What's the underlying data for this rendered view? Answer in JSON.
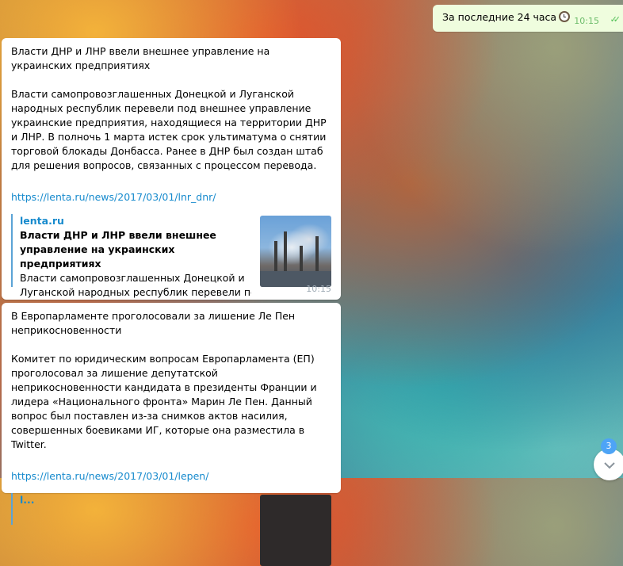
{
  "outgoing": {
    "text": "За последние 24 часа",
    "time": "10:15",
    "status_icon": "double-check-icon",
    "emoji_icon": "clock-icon"
  },
  "messages": [
    {
      "headline": "Власти ДНР и ЛНР ввели внешнее управление на украинских предприятиях",
      "body": "Власти самопровозглашенных Донецкой и Луганской народных республик перевели под внешнее управление украинские предприятия, находящиеся на территории ДНР и ЛНР. В полночь 1 марта истек срок ультиматума о снятии торговой блокады Донбасса. Ранее в ДНР был создан штаб для решения вопросов, связанных с процессом перевода.",
      "link": "https://lenta.ru/news/2017/03/01/lnr_dnr/",
      "preview": {
        "site": "lenta.ru",
        "title": "Власти ДНР и ЛНР ввели внешнее управление на украинских предприятиях",
        "text_line1": "Власти самопровозглашенных Донецкой и",
        "text_line2": "Луганской народных республик перевели по…"
      },
      "time": "10:15"
    },
    {
      "headline": "В Европарламенте проголосовали за лишение Ле Пен неприкосновенности",
      "body": "Комитет по юридическим вопросам Европарламента (ЕП) проголосовал за лишение депутатской неприкосновенности кандидата в президенты Франции и лидера «Национального фронта» Марин Ле Пен. Данный вопрос был поставлен из-за снимков актов насилия, совершенных боевиками ИГ, которые она разместила в Twitter.",
      "link": "https://lenta.ru/news/2017/03/01/lepen/",
      "preview_site_partial": "l..."
    }
  ],
  "scroll_down": {
    "unread_count": "3",
    "icon": "chevron-down-icon"
  }
}
